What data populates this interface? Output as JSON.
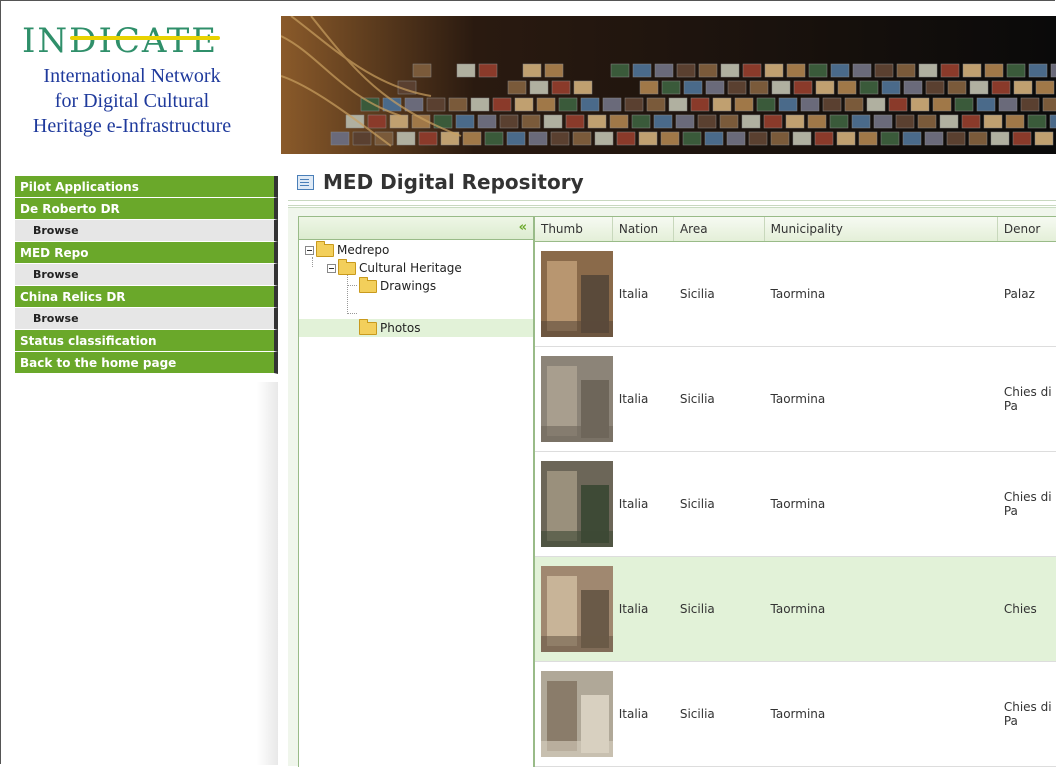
{
  "logo": {
    "word": "INDICATE",
    "subtitle_lines": [
      "International Network",
      "for Digital Cultural",
      "Heritage e-Infrastructure"
    ]
  },
  "sidebar": {
    "items": [
      {
        "label": "Pilot Applications",
        "type": "section"
      },
      {
        "label": "De Roberto DR",
        "type": "section"
      },
      {
        "label": "Browse",
        "type": "sub"
      },
      {
        "label": "MED Repo",
        "type": "section"
      },
      {
        "label": "Browse",
        "type": "sub"
      },
      {
        "label": "China Relics DR",
        "type": "section"
      },
      {
        "label": "Browse",
        "type": "sub"
      },
      {
        "label": "Status classification",
        "type": "section"
      },
      {
        "label": "Back to the home page",
        "type": "section"
      }
    ]
  },
  "page": {
    "title": "MED Digital Repository"
  },
  "tree": {
    "collapse_glyph": "«",
    "nodes": [
      {
        "label": "Medrepo",
        "level": 0
      },
      {
        "label": "Cultural Heritage",
        "level": 1
      },
      {
        "label": "Drawings",
        "level": 2
      },
      {
        "label": "Photos",
        "level": 2,
        "selected": true
      }
    ]
  },
  "grid": {
    "columns": [
      "Thumb",
      "Nation",
      "Area",
      "Municipality",
      "Denor"
    ],
    "rows": [
      {
        "nation": "Italia",
        "area": "Sicilia",
        "municipality": "Taormina",
        "denomination": "Palaz",
        "selected": false
      },
      {
        "nation": "Italia",
        "area": "Sicilia",
        "municipality": "Taormina",
        "denomination": "Chies di Pa",
        "selected": false
      },
      {
        "nation": "Italia",
        "area": "Sicilia",
        "municipality": "Taormina",
        "denomination": "Chies di Pa",
        "selected": false
      },
      {
        "nation": "Italia",
        "area": "Sicilia",
        "municipality": "Taormina",
        "denomination": "Chies",
        "selected": true
      },
      {
        "nation": "Italia",
        "area": "Sicilia",
        "municipality": "Taormina",
        "denomination": "Chies di Pa",
        "selected": false
      }
    ]
  },
  "colors": {
    "accent_green": "#6aa82a",
    "selection": "#e2f2d8",
    "logo_blue": "#1f3a9c"
  }
}
